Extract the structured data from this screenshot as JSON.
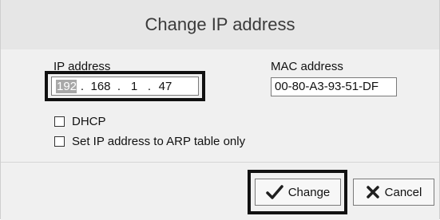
{
  "dialog": {
    "title": "Change IP address",
    "ip": {
      "label": "IP address",
      "octets": [
        "192",
        "168",
        "1",
        "47"
      ],
      "separator": "."
    },
    "mac": {
      "label": "MAC address",
      "value": "00-80-A3-93-51-DF"
    },
    "options": {
      "dhcp_label": "DHCP",
      "dhcp_checked": false,
      "arp_label": "Set IP address to ARP table only",
      "arp_checked": false
    },
    "buttons": {
      "change_label": "Change",
      "change_icon": "checkmark-icon",
      "cancel_label": "Cancel",
      "cancel_icon": "x-icon"
    }
  }
}
